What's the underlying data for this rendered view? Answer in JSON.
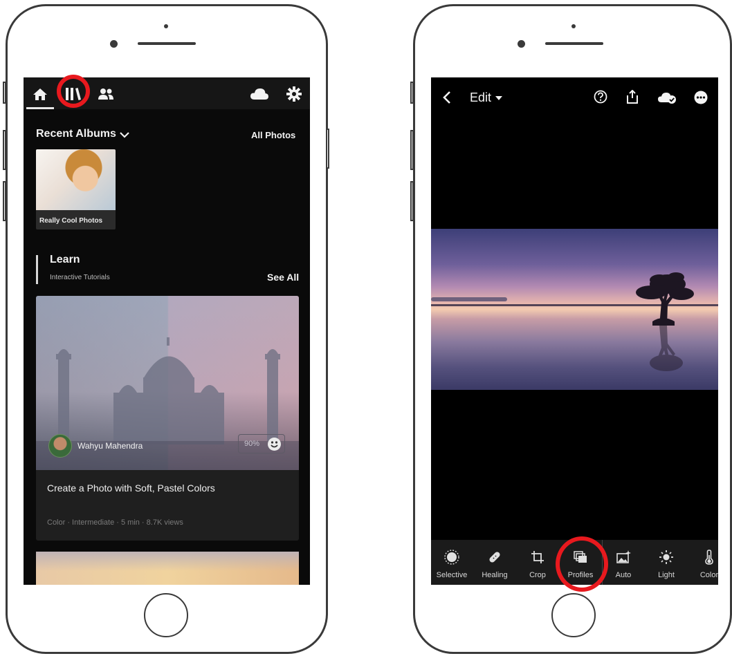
{
  "left_app": {
    "recent_albums_title": "Recent Albums",
    "all_photos_link": "All Photos",
    "album": {
      "label": "Really Cool Photos"
    },
    "learn": {
      "title": "Learn",
      "subtitle": "Interactive Tutorials",
      "see_all": "See All"
    },
    "tutorial_card": {
      "author": "Wahyu Mahendra",
      "rating": "90%",
      "title": "Create a Photo with Soft, Pastel Colors",
      "meta": "Color · Intermediate · 5 min · 8.7K views"
    },
    "nav_icons": [
      "home-icon",
      "library-icon",
      "people-icon",
      "cloud-icon",
      "gear-icon"
    ]
  },
  "right_app": {
    "edit_label": "Edit",
    "toolbar": [
      {
        "label": "Selective",
        "icon": "selective-icon"
      },
      {
        "label": "Healing",
        "icon": "healing-icon"
      },
      {
        "label": "Crop",
        "icon": "crop-icon"
      },
      {
        "label": "Profiles",
        "icon": "profiles-icon"
      },
      {
        "label": "Auto",
        "icon": "auto-icon"
      },
      {
        "label": "Light",
        "icon": "light-icon"
      },
      {
        "label": "Color",
        "icon": "color-icon"
      }
    ],
    "top_icons": [
      "back-icon",
      "help-icon",
      "share-icon",
      "cloud-synced-icon",
      "more-icon"
    ]
  },
  "colors": {
    "highlight_ring": "#e8191e",
    "screen_bg": "#0a0a0a",
    "toolbar_bg": "#1b1b1b"
  }
}
